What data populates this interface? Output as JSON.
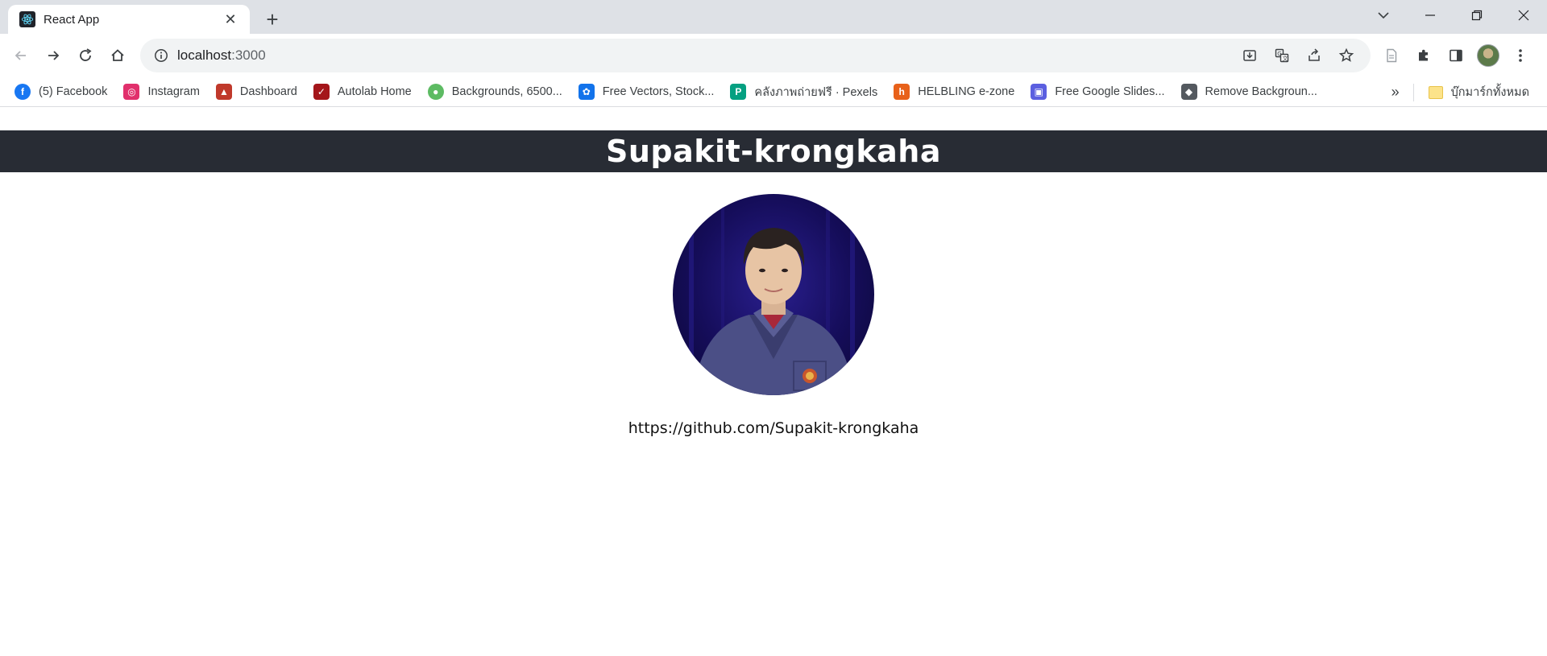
{
  "browser": {
    "tab": {
      "title": "React App",
      "favicon": "react-icon"
    },
    "address": {
      "host": "localhost",
      "port": ":3000"
    },
    "bookmarks": [
      {
        "label": "(5) Facebook",
        "icon": "facebook-icon",
        "color": "#1877f2"
      },
      {
        "label": "Instagram",
        "icon": "instagram-icon",
        "color": "#e1306c"
      },
      {
        "label": "Dashboard",
        "icon": "rocket-icon",
        "color": "#c0392b"
      },
      {
        "label": "Autolab Home",
        "icon": "autolab-icon",
        "color": "#a4161a"
      },
      {
        "label": "Backgrounds, 6500...",
        "icon": "backgrounds-icon",
        "color": "#5dbb63"
      },
      {
        "label": "Free Vectors, Stock...",
        "icon": "freepik-icon",
        "color": "#1273eb"
      },
      {
        "label": "คลังภาพถ่ายฟรี · Pexels",
        "icon": "pexels-icon",
        "color": "#05a081"
      },
      {
        "label": "HELBLING e-zone",
        "icon": "helbling-icon",
        "color": "#e8611a"
      },
      {
        "label": "Free Google Slides...",
        "icon": "slidesgo-icon",
        "color": "#5b5fe0"
      },
      {
        "label": "Remove Backgroun...",
        "icon": "removebg-icon",
        "color": "#54595f"
      }
    ],
    "bookmarks_more": "»",
    "all_bookmarks": "บุ๊กมาร์กทั้งหมด"
  },
  "page": {
    "heading": "Supakit-krongkaha",
    "photo_alt": "profile-photo",
    "github_url": "https://github.com/Supakit-krongkaha"
  },
  "colors": {
    "header_bg": "#282c34",
    "header_text": "#ffffff",
    "tabstrip_bg": "#dee1e6"
  }
}
